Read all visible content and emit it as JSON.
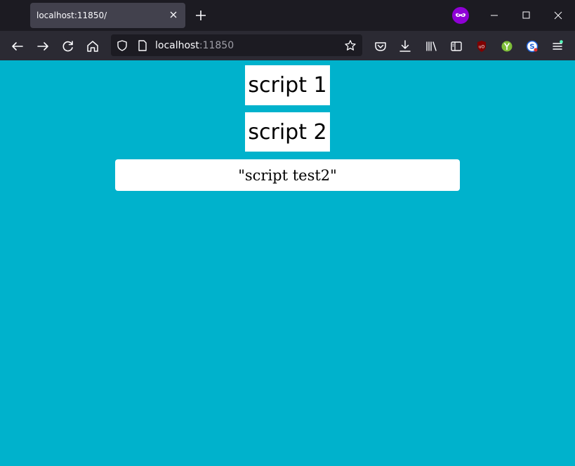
{
  "browser": {
    "tab": {
      "title": "localhost:11850/"
    },
    "url": {
      "host": "localhost",
      "port": ":11850"
    },
    "colors": {
      "chrome_dark": "#1c1b22",
      "toolbar": "#2b2a33",
      "tab_active": "#42414d",
      "private_badge": "#8f00d6"
    },
    "toolbar_icons": [
      "back-icon",
      "forward-icon",
      "reload-icon",
      "home-icon",
      "shield-icon",
      "page-icon",
      "bookmark-star-icon",
      "pocket-icon",
      "download-icon",
      "library-icon",
      "sidebar-icon",
      "ublock-icon",
      "extension-y-icon",
      "extension-s-icon",
      "menu-icon"
    ]
  },
  "page": {
    "background": "#00b2cc",
    "buttons": [
      {
        "label": "script 1"
      },
      {
        "label": "script 2"
      }
    ],
    "result": "\"script test2\""
  }
}
